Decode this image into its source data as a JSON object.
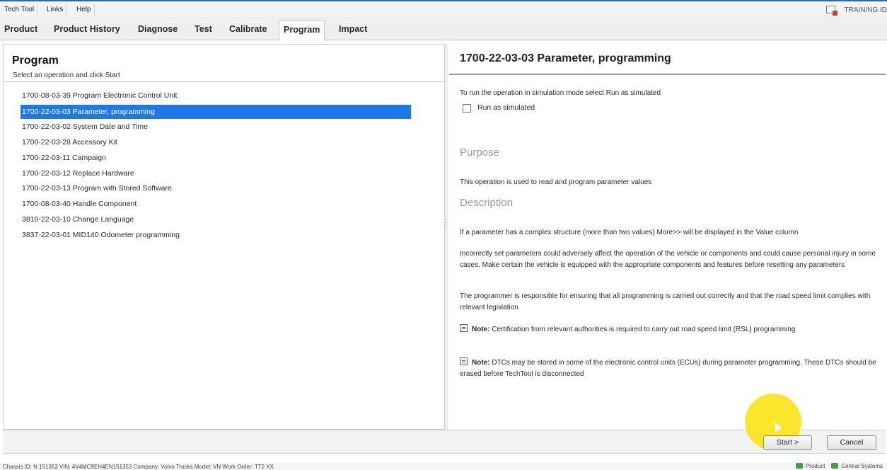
{
  "menu": {
    "items": [
      "Tech Tool",
      "Links",
      "Help"
    ],
    "training_label": "TRAINING ID"
  },
  "tabs": [
    "Product",
    "Product History",
    "Diagnose",
    "Test",
    "Calibrate",
    "Program",
    "Impact"
  ],
  "active_tab": "Program",
  "left": {
    "title": "Program",
    "subtitle": "Select an operation and click Start",
    "operations": [
      "1700-08-03-39 Program Electronic Control Unit",
      "1700-22-03-03 Parameter, programming",
      "1700-22-03-02 System Date and Time",
      "1700-22-03-28 Accessory Kit",
      "1700-22-03-11 Campaign",
      "1700-22-03-12 Replace Hardware",
      "1700-22-03-13 Program with Stored Software",
      "1700-08-03-40 Handle Component",
      "3810-22-03-10 Change Language",
      "3837-22-03-01 MID140 Odometer programming"
    ],
    "selected_index": 1
  },
  "right": {
    "title": "1700-22-03-03 Parameter, programming",
    "simulation_text": "To run the operation in simulation mode select Run as simulated",
    "run_simulated_label": "Run as simulated",
    "run_simulated_checked": false,
    "purpose_heading": "Purpose",
    "purpose_text": "This operation is used to read and program parameter values",
    "description_heading": "Description",
    "desc_1": "If a parameter has a complex structure (more than two values) More>> will be displayed in the Value column",
    "desc_2": "Incorrectly set parameters could adversely affect the operation of the vehicle or components and could cause personal injury in some cases. Make certain the vehicle is equipped with the appropriate components and features before resetting any parameters",
    "desc_3": "The programmer is responsible for ensuring that all programming is carried out correctly and that the road speed limit complies with relevant legislation",
    "note_label": "Note:",
    "note_1": "Certification from relevant authorities is required to carry out road speed limit (RSL) programming",
    "note_2": "DTCs may be stored in some of the electronic control units (ECUs) during parameter programming. These DTCs should be erased before TechTool is disconnected"
  },
  "buttons": {
    "start": "Start >",
    "cancel": "Cancel"
  },
  "status": {
    "left": "Chassis ID: N 151353    VIN: 4V4MC9EH4EN151353    Company: Volvo Trucks    Model: VN    Work Order: TT2 XX",
    "product": "Product",
    "central_systems": "Central Systems"
  },
  "colors": {
    "selection": "#1d79e6",
    "highlight": "#fae414"
  }
}
